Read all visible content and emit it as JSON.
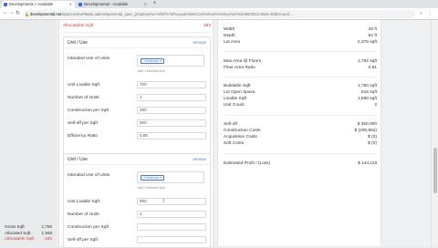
{
  "browser": {
    "tabs": [
      {
        "title": "Developments > Available"
      },
      {
        "title": "Developmental - Available"
      }
    ],
    "new_tab": "+",
    "url_host": "developmental.net",
    "url_path": "/spaces/new#ttask=&developmental_spec_property#ra=%f9F%7B%equantitiesCost%3%3A%%key%3A%5489/3022-68a5-4b823-ae1f...",
    "nav_back": "←",
    "nav_forward": "→",
    "nav_reload": "↻",
    "toolbar_icons": "☆ ⋮"
  },
  "form": {
    "allocatable_label": "Allocatable Sqft",
    "allocatable_value": "183",
    "units": [
      {
        "header": "Unit / Use",
        "remove": "remove",
        "intended_use_label": "Intended Use of Units",
        "intended_use_value": "1 bedroom",
        "intended_use_help": "Add 1 intended Use",
        "livable_label": "Unit Livable Sqft",
        "livable_value": "700",
        "number_label": "Number of Units",
        "number_value": "1",
        "construction_label": "Construction per Sqft",
        "construction_value": "250",
        "selloff_label": "Sell-off per Sqft",
        "selloff_value": "500",
        "efficiency_label": "Efficiency Ratio",
        "efficiency_value": "0.85"
      },
      {
        "header": "Unit / Use",
        "remove": "remove",
        "intended_use_label": "Intended Use of Units",
        "intended_use_value": "2 bedroom",
        "intended_use_help": "Add 2 intended Use",
        "livable_label": "Unit Livable Sqft",
        "livable_value": "850",
        "number_label": "Number of Units",
        "number_value": "1",
        "construction_label": "Construction per Sqft",
        "construction_value": "",
        "selloff_label": "Sell-off per Sqft",
        "selloff_value": ""
      }
    ]
  },
  "summary": {
    "rows": [
      {
        "label": "Gross Sqft",
        "value": "1,760"
      },
      {
        "label": "Allocated Sqft",
        "value": "1,948"
      },
      {
        "label": "Allocatable Sqft",
        "value": "-183"
      }
    ]
  },
  "results": {
    "rows": [
      {
        "label": "Width",
        "value": "29 ft"
      },
      {
        "label": "Depth",
        "value": "82 ft"
      },
      {
        "label": "Lot Area",
        "value": "2,376 sqft"
      },
      {
        "label": "Max Area @ Floors",
        "value": "1,762 sqft"
      },
      {
        "label": "Floor Area Ratio",
        "value": "0.81"
      },
      {
        "label": "Buildable Sqft",
        "value": "1,760 sqft"
      },
      {
        "label": "Lot Open Space",
        "value": "616 sqft"
      },
      {
        "label": "Livable Sqft",
        "value": "1,650 sqft"
      },
      {
        "label": "Unit Count",
        "value": "2"
      },
      {
        "label": "Sell-off",
        "value": "$ 350,000"
      },
      {
        "label": "Construction Costs",
        "value": "$ (205,882)"
      },
      {
        "label": "Acquisition Costs",
        "value": "$ (0)"
      },
      {
        "label": "Soft Costs",
        "value": "$ (0)"
      },
      {
        "label": "Estimated Profit / (Loss)",
        "value": "$ 144,118"
      }
    ]
  }
}
